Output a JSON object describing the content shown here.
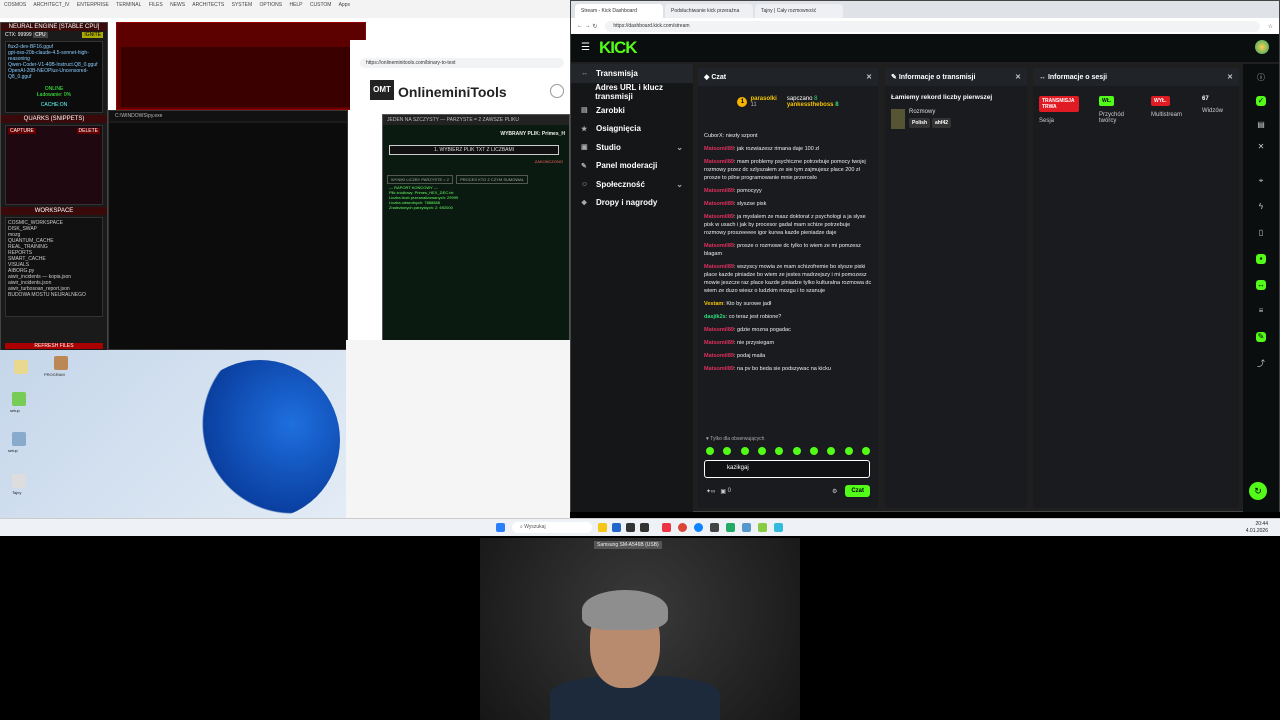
{
  "desktop": {
    "topbar_items": [
      "COSMOS",
      "ARCHITECT_IV",
      "ENTERPRISE",
      "TERMINAL",
      "FILES",
      "NEWS",
      "ARCHITECTS",
      "SYSTEM",
      "OPTIONS",
      "HELP",
      "CUSTOM",
      "Apps"
    ],
    "neural": {
      "title": "NEURAL ENGINE [STABLE CPU]",
      "ctx": "CTX: 99999",
      "cpu": "CPU",
      "ignite": "IGNITE",
      "models": [
        "flux2-dev-BF16.gguf",
        "gpt-oss-20b-claude-4.5-sonnet-high-reasoning",
        "Qwen-Coder-V1-40B-Instruct.Q8_0.gguf",
        "OpenAI-20B-NEOPlus-Uncensored-Q8_0.gguf"
      ],
      "online": "ONLINE",
      "loading": "Ładowanie: 0%",
      "cache": "CACHE:ON",
      "quarks": "QUARKS (SNIPPETS)",
      "capture": "CAPTURE",
      "delete": "DELETE",
      "workspace": "WORKSPACE",
      "tree": [
        "COSMIC_WORKSPACE",
        "DISK_SWAP",
        "mozg",
        "QUANTUM_CACHE",
        "REAL_TRAINING",
        "REPORTS",
        "SMART_CACHE",
        "VISUALS",
        "AIBORG.py",
        "aiwir_incidents — kopia.json",
        "aiwir_incidents.json",
        "aiwir_turbosoan_report.json",
        "BUDOWA MOSTU NEURALNEGO"
      ],
      "refresh": "REFRESH FILES"
    },
    "omt": {
      "title": "OnlineminiTools",
      "logo": "OMT",
      "url": "https://onlineminitools.com/binary-to-text"
    },
    "cmd": {
      "title": "C:\\WINDOWS\\py.exe"
    },
    "primes": {
      "title": "JEDEN NA SZCZYSTY — PARZYSTE = 2 ZAWSZE PLIKU",
      "selected": "WYBRANY PLIK: Primes_H",
      "button": "1. WYBIERZ PLIK TXT Z LICZBAMI",
      "done": "ZAKOŃCZONO",
      "tab1": "WYNIKI LICZBY PARZYSTE = 2",
      "tab2": "PROCES KTO Z CZYM SUMOWAŁ",
      "log": "--- RAPORT KOŃCOWY ---\nPlik źródłowy: Primes_HEX_DEC.txt\nLiczba liczb przeanalizowanych: 29999\nLiczba odwrotnych: 7888888\nZnalezionych parzystych: 2: 692000"
    },
    "icons": [
      "Kosz",
      "PROGRAM",
      "setup",
      "setup",
      "Tajny"
    ]
  },
  "browser": {
    "tabs": [
      "Stream - Kick Dashboard",
      "Podsłuchiwanie kick przeraźna",
      "Tajny | Cały rozmowność"
    ],
    "url": "https://dashboard.kick.com/stream",
    "logo": "KICK",
    "sidebar": [
      {
        "icon": "↔",
        "label": "Transmisja",
        "active": true,
        "chev": false
      },
      {
        "icon": "",
        "label": "Adres URL i klucz transmisji",
        "active": false,
        "chev": false
      },
      {
        "icon": "▤",
        "label": "Zarobki",
        "active": false,
        "chev": false
      },
      {
        "icon": "★",
        "label": "Osiągnięcia",
        "active": false,
        "chev": false
      },
      {
        "icon": "▣",
        "label": "Studio",
        "active": false,
        "chev": true
      },
      {
        "icon": "✎",
        "label": "Panel moderacji",
        "active": false,
        "chev": false
      },
      {
        "icon": "☺",
        "label": "Społeczność",
        "active": false,
        "chev": true
      },
      {
        "icon": "❖",
        "label": "Dropy i nagrody",
        "active": false,
        "chev": false
      }
    ],
    "chat": {
      "title": "Czat",
      "leader1": "parasolki",
      "leader1_count": "11",
      "leader2": "sapczano",
      "leader2_count": "8",
      "leader3": "yankesstheboss",
      "leader3_count": "8",
      "messages": [
        {
          "user": "CuborX",
          "color": "u-plain",
          "text": "niezły szpont"
        },
        {
          "user": "Matsomil89",
          "color": "u-red",
          "text": "jak rozwiazesz rimana daje 100 zl"
        },
        {
          "user": "Matsomil89",
          "color": "u-red",
          "text": "mam problemy psychiczne potrzebuje pomocy twojej rozmowy przez dc szlyszałem ze sie tym zajmujesz place 200 zł prosze to pilne programowanie mnie przerosło"
        },
        {
          "user": "Matsomil89",
          "color": "u-red",
          "text": "pomocyyy"
        },
        {
          "user": "Matsomil89",
          "color": "u-red",
          "text": "slyszse pisk"
        },
        {
          "user": "Matsomil89",
          "color": "u-red",
          "text": "ja myslalem ze masz doktorat z psychologi a ja slyse pisk w usach i jak by procesor gadal mam schize potrzebuje rozmowy proszeeeee igor kurwa kazde pieniadze daje"
        },
        {
          "user": "Matsomil89",
          "color": "u-red",
          "text": "prosze o rozmowe dc tylko to wiem ze mi pomzesz blagam"
        },
        {
          "user": "Matsomil89",
          "color": "u-red",
          "text": "wszyscy mowia ze mam schizofremie bo slysze piski place kazde piniadze bo wiem ze jestes madrzejszy i mi pomozesz mowie jeszcze raz place kazde piniadze tylko kulturalna rozmowa dc wiem ze duzo wiesz o ludzkim mozgu i to szanuje"
        },
        {
          "user": "Vestam",
          "color": "u-yel",
          "text": "Kto by surowe jadł"
        },
        {
          "user": "dasjik2s",
          "color": "u-grn",
          "text": "co teraz jest robione?"
        },
        {
          "user": "Matsomil89",
          "color": "u-red",
          "text": "gdzie mozna pogadac"
        },
        {
          "user": "Matsomil89",
          "color": "u-red",
          "text": "nie przysiegam"
        },
        {
          "user": "Matsomil89",
          "color": "u-red",
          "text": "podaj maila"
        },
        {
          "user": "Matsomil89",
          "color": "u-red",
          "text": "na pv bo beda sie podszywac na kicku"
        }
      ],
      "followers_only": "♥ Tylko dla obserwujących",
      "input_value": "kazikgaj",
      "count": "0",
      "send": "Czat"
    },
    "info": {
      "title": "Informacje o transmisji",
      "stream_title": "Łamiemy rekord liczby pierwszej",
      "category": "Rozmowy",
      "tag1": "Polish",
      "tag2": "ahf42"
    },
    "session": {
      "title": "Informacje o sesji",
      "live": "TRANSMISJA TRWA",
      "on": "WŁ.",
      "off": "WYŁ.",
      "viewers": "67",
      "session": "Sesja",
      "income": "Przychód twórcy",
      "multistream": "Multistream",
      "viewers_label": "Widzów"
    }
  },
  "taskbar": {
    "search": "Wyszukaj",
    "time": "20:44",
    "date": "4.01.2026"
  },
  "webcam": {
    "title": "Samsung SM-A546B (USB)"
  }
}
